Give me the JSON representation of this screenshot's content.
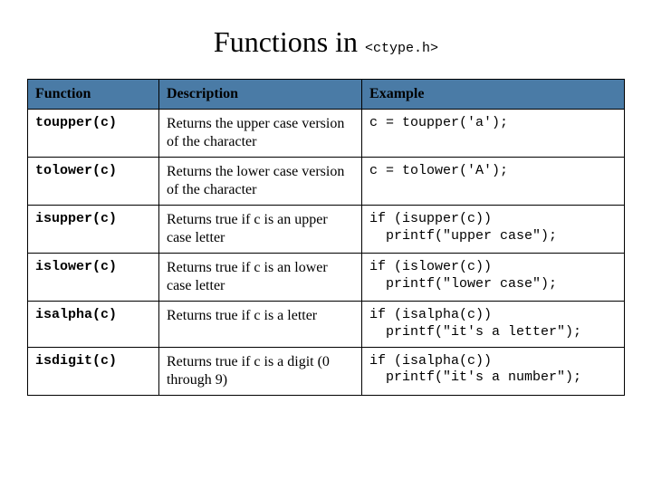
{
  "title_prefix": "Functions in ",
  "title_code": "<ctype.h>",
  "headers": {
    "function": "Function",
    "description": "Description",
    "example": "Example"
  },
  "rows": [
    {
      "func": "toupper(c)",
      "desc": "Returns the upper case version of the character",
      "example": "c = toupper('a');"
    },
    {
      "func": "tolower(c)",
      "desc": "Returns the lower case version of the character",
      "example": "c = tolower('A');"
    },
    {
      "func": "isupper(c)",
      "desc": "Returns true if c is an upper case letter",
      "example": "if (isupper(c))\n  printf(\"upper case\");"
    },
    {
      "func": "islower(c)",
      "desc": "Returns true if c is an lower case letter",
      "example": "if (islower(c))\n  printf(\"lower case\");"
    },
    {
      "func": "isalpha(c)",
      "desc": "Returns true if c is a letter",
      "example": "if (isalpha(c))\n  printf(\"it's a letter\");"
    },
    {
      "func": "isdigit(c)",
      "desc": "Returns true if c is a digit (0 through 9)",
      "example": "if (isalpha(c))\n  printf(\"it's a number\");"
    }
  ]
}
